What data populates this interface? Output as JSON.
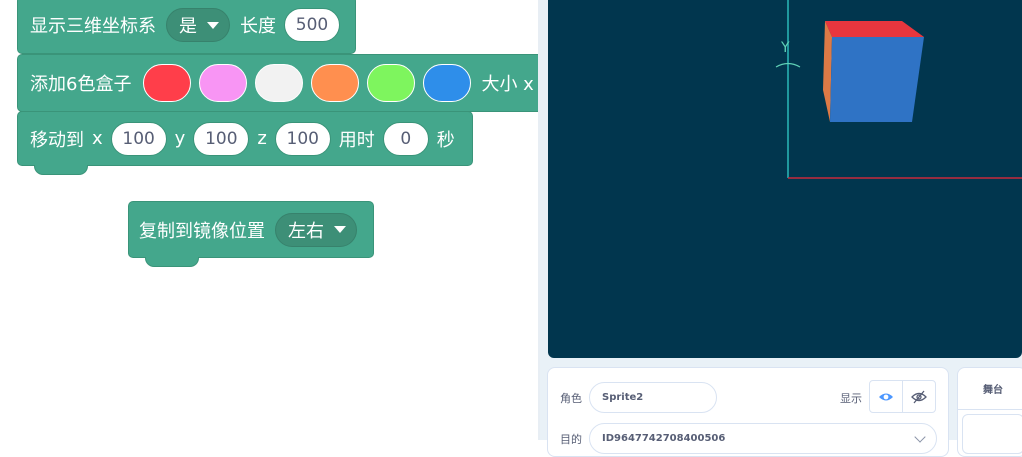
{
  "blocks": {
    "show_axes": {
      "label": "显示三维坐标系",
      "option": "是",
      "length_label": "长度",
      "length_value": "500"
    },
    "add_boxes": {
      "label": "添加6色盒子",
      "colors": [
        "#ff3e4a",
        "#f895f4",
        "#f2f2f2",
        "#ff8f4f",
        "#7ef55e",
        "#2e8eea"
      ],
      "size_label": "大小 x"
    },
    "move_to": {
      "label": "移动到",
      "x_label": "x",
      "x_value": "100",
      "y_label": "y",
      "y_value": "100",
      "z_label": "z",
      "z_value": "100",
      "time_label": "用时",
      "time_value": "0",
      "unit_label": "秒"
    },
    "mirror_copy": {
      "label": "复制到镜像位置",
      "option": "左右"
    }
  },
  "stage": {
    "background": "#01364e",
    "y_axis_label": "Y",
    "y_axis_color": "#2ab8b8",
    "x_axis_color": "#c8283c",
    "cube_colors": {
      "top": "#e8363e",
      "front": "#2f73c5",
      "side": "#dd7a46"
    }
  },
  "sprite_panel": {
    "sprite_label": "角色",
    "sprite_name": "Sprite2",
    "show_label": "显示",
    "id_label": "目的",
    "id_value": "ID9647742708400506"
  },
  "stage_panel": {
    "label": "舞台"
  }
}
